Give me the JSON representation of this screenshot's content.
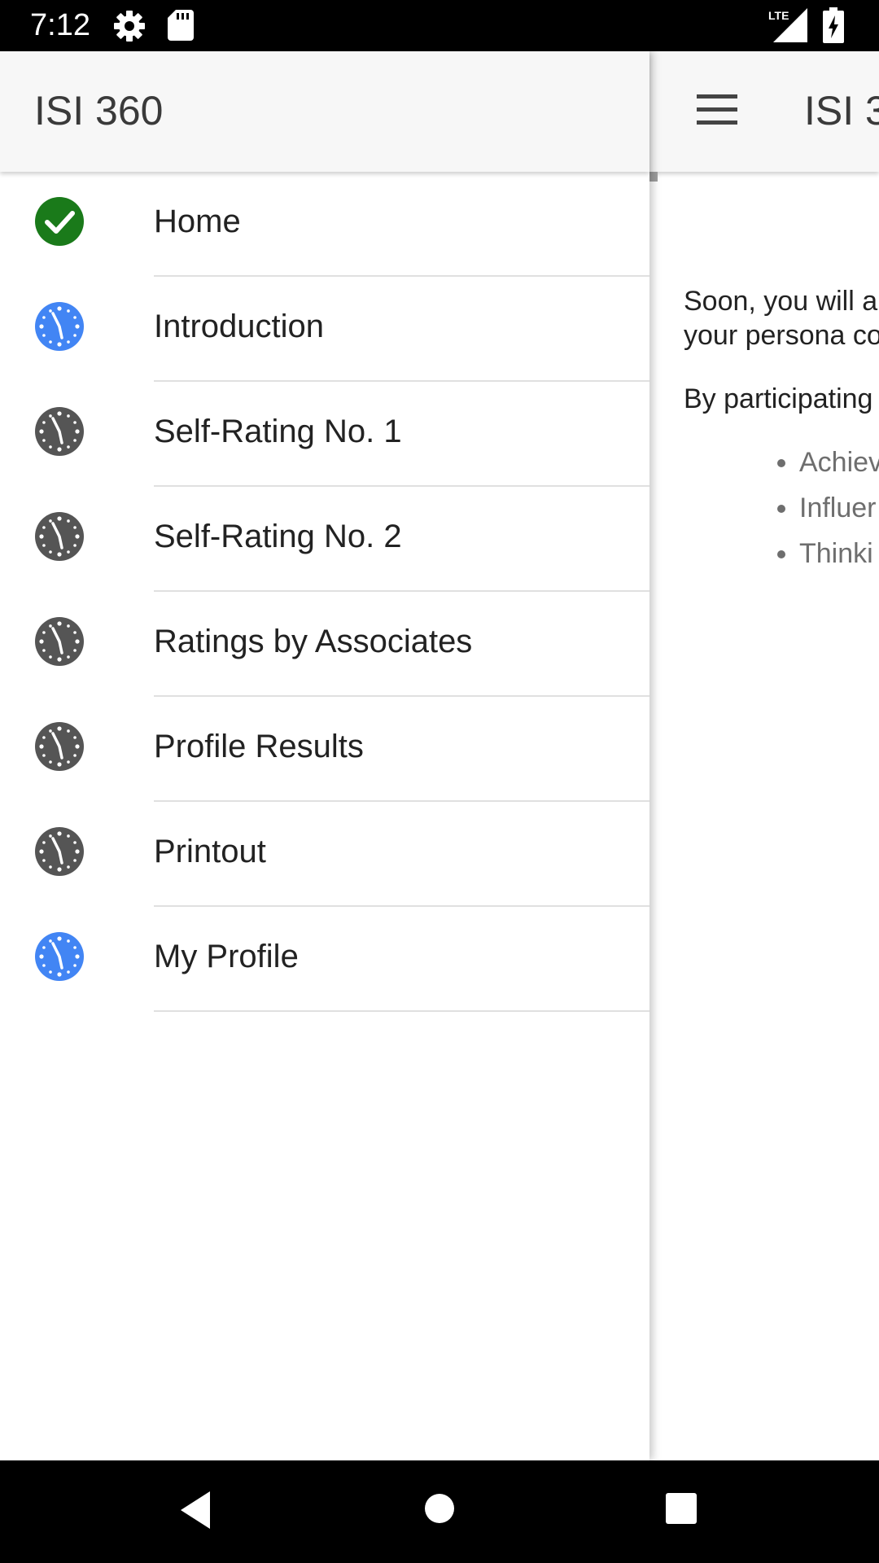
{
  "status_bar": {
    "time": "7:12",
    "icons": [
      "gear-icon",
      "sd-card-icon",
      "lte-signal-icon",
      "battery-charging-icon"
    ],
    "network_label": "LTE"
  },
  "drawer": {
    "title": "ISI 360",
    "items": [
      {
        "label": "Home",
        "icon": "check-circle-icon",
        "status": "complete",
        "icon_color": "#1a7a1a"
      },
      {
        "label": "Introduction",
        "icon": "clock-icon",
        "status": "available",
        "icon_color": "#4285f4"
      },
      {
        "label": "Self-Rating No. 1",
        "icon": "clock-icon",
        "status": "locked",
        "icon_color": "#555555"
      },
      {
        "label": "Self-Rating No. 2",
        "icon": "clock-icon",
        "status": "locked",
        "icon_color": "#555555"
      },
      {
        "label": "Ratings by Associates",
        "icon": "clock-icon",
        "status": "locked",
        "icon_color": "#555555"
      },
      {
        "label": "Profile Results",
        "icon": "clock-icon",
        "status": "locked",
        "icon_color": "#555555"
      },
      {
        "label": "Printout",
        "icon": "clock-icon",
        "status": "locked",
        "icon_color": "#555555"
      },
      {
        "label": "My Profile",
        "icon": "clock-icon",
        "status": "available",
        "icon_color": "#4285f4"
      }
    ]
  },
  "main": {
    "title": "ISI 3",
    "paragraph1": "Soon, you will a Influence. Your to your persona contributor, neg agent.",
    "paragraph2": "By participating effectiveness a",
    "bullets": [
      "Achiev buildir",
      "Influer situati",
      "Thinki influer influer approa"
    ]
  },
  "nav_bar": {
    "buttons": [
      "back-icon",
      "home-icon",
      "recents-icon"
    ]
  }
}
